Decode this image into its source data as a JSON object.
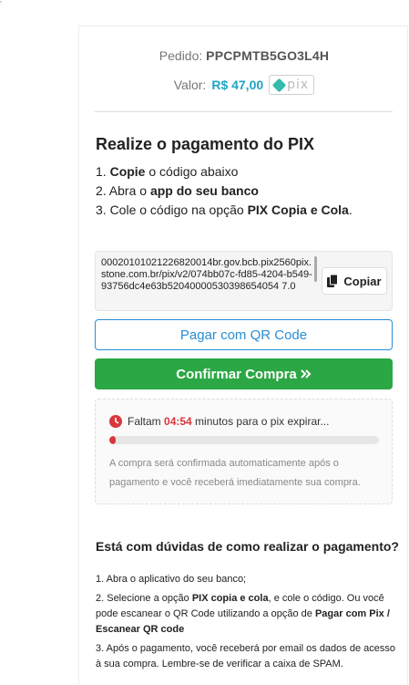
{
  "order": {
    "label": "Pedido:",
    "code": "PPCPMTB5GO3L4H"
  },
  "amount": {
    "label": "Valor:",
    "value": "R$ 47,00",
    "pix_logo_text": "pix",
    "pix_logo_color": "#32bcad"
  },
  "instructions": {
    "title": "Realize o pagamento do PIX",
    "step1_prefix": "1. ",
    "step1_bold": "Copie",
    "step1_rest": " o código abaixo",
    "step2_prefix": "2. Abra o ",
    "step2_bold": "app do seu banco",
    "step3_prefix": "3. Cole o código na opção ",
    "step3_bold": "PIX Copia e Cola",
    "step3_suffix": "."
  },
  "pix_code": {
    "value": "00020101021226820014br.gov.bcb.pix2560pix.stone.com.br/pix/v2/074bb07c-fd85-4204-b549-93756dc4e63b52040000530398654054 7.0",
    "copy_label": "Copiar",
    "copy_icon": "copy-icon"
  },
  "buttons": {
    "qr_label": "Pagar com QR Code",
    "confirm_label": "Confirmar Compra",
    "confirm_icon": "double-chevron-right-icon",
    "confirm_color": "#2ba745",
    "qr_color": "#2a8dd4"
  },
  "timer": {
    "prefix": "Faltam ",
    "time": "04:54",
    "suffix": " minutos para o pix expirar...",
    "progress_fraction": 0.02,
    "note": "A compra será confirmada automaticamente após o pagamento e você receberá imediatamente sua compra.",
    "accent": "#d9363e"
  },
  "faq": {
    "title": "Está com dúvidas de como realizar o pagamento?",
    "item1": "1. Abra o aplicativo do seu banco;",
    "item2_a": "2. Selecione a opção ",
    "item2_b": "PIX copia e cola",
    "item2_c": ", e cole o código. Ou você pode escanear o QR Code utilizando a opção de ",
    "item2_d": "Pagar com Pix / Escanear QR code",
    "item3": "3. Após o pagamento, você receberá por email os dados de acesso à sua compra. Lembre-se de verificar a caixa de SPAM."
  }
}
